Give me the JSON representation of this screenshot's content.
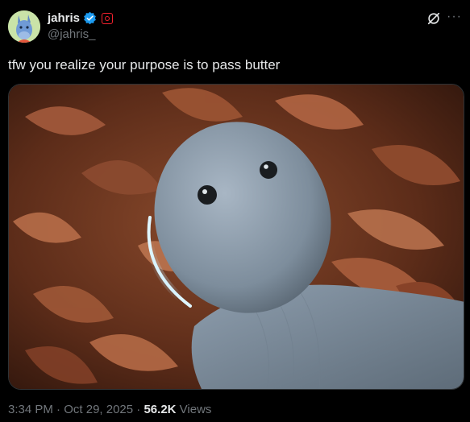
{
  "author": {
    "display_name": "jahris",
    "handle": "@jahris_",
    "avatar": "blue-donkey-avatar",
    "verified_icon": "verified-badge-icon",
    "affiliate_icon": "affiliate-badge-icon"
  },
  "actions": {
    "grok_icon": "grok-icon",
    "more_label": "···"
  },
  "tweet": {
    "text": "tfw you realize your purpose is to pass butter",
    "media_description_icon": "photo"
  },
  "meta": {
    "time": "3:34 PM",
    "sep": "·",
    "date": "Oct 29, 2025",
    "views_count": "56.2K",
    "views_label": "Views"
  },
  "colors": {
    "background": "#000000",
    "text": "#e7e9ea",
    "muted": "#71767b",
    "verified": "#1d9bf0",
    "affiliate": "#f4212e"
  }
}
